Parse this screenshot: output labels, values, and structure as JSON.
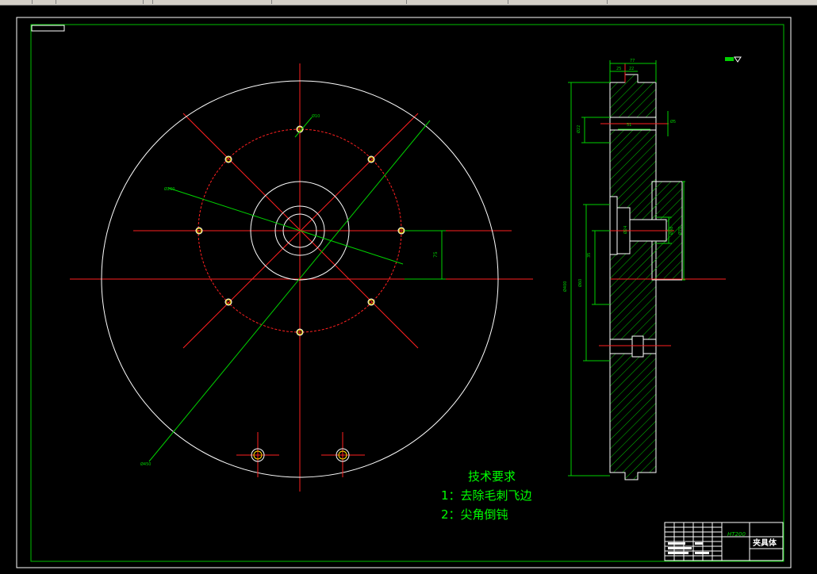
{
  "drawing": {
    "notes_title": "技术要求",
    "notes": [
      "1：去除毛刺飞边",
      "2：尖角倒钝"
    ],
    "title_block": {
      "material": "HT200",
      "part_name": "夹具体"
    },
    "dims": {
      "front_top": "77",
      "front_sub1": "25",
      "front_sub2": "22",
      "top_bore": "Ø22",
      "top_slot": "51",
      "small_right": "Ø5",
      "center_left": "Ø60",
      "center_left2": "Ø50",
      "center_mid": "Ø24",
      "center_right": "Ø38",
      "center_right2": "Ø70",
      "overall": "Ø400",
      "offset_vertical": "75",
      "pcd": "Ø260",
      "bolt_hole": "Ø10",
      "outer": "Ø450",
      "left_dim": "35"
    }
  },
  "colors": {
    "outline": "#ffffff",
    "center": "#ff2020",
    "dim": "#00d000",
    "text": "#00ff00",
    "frame": "#00c000"
  }
}
